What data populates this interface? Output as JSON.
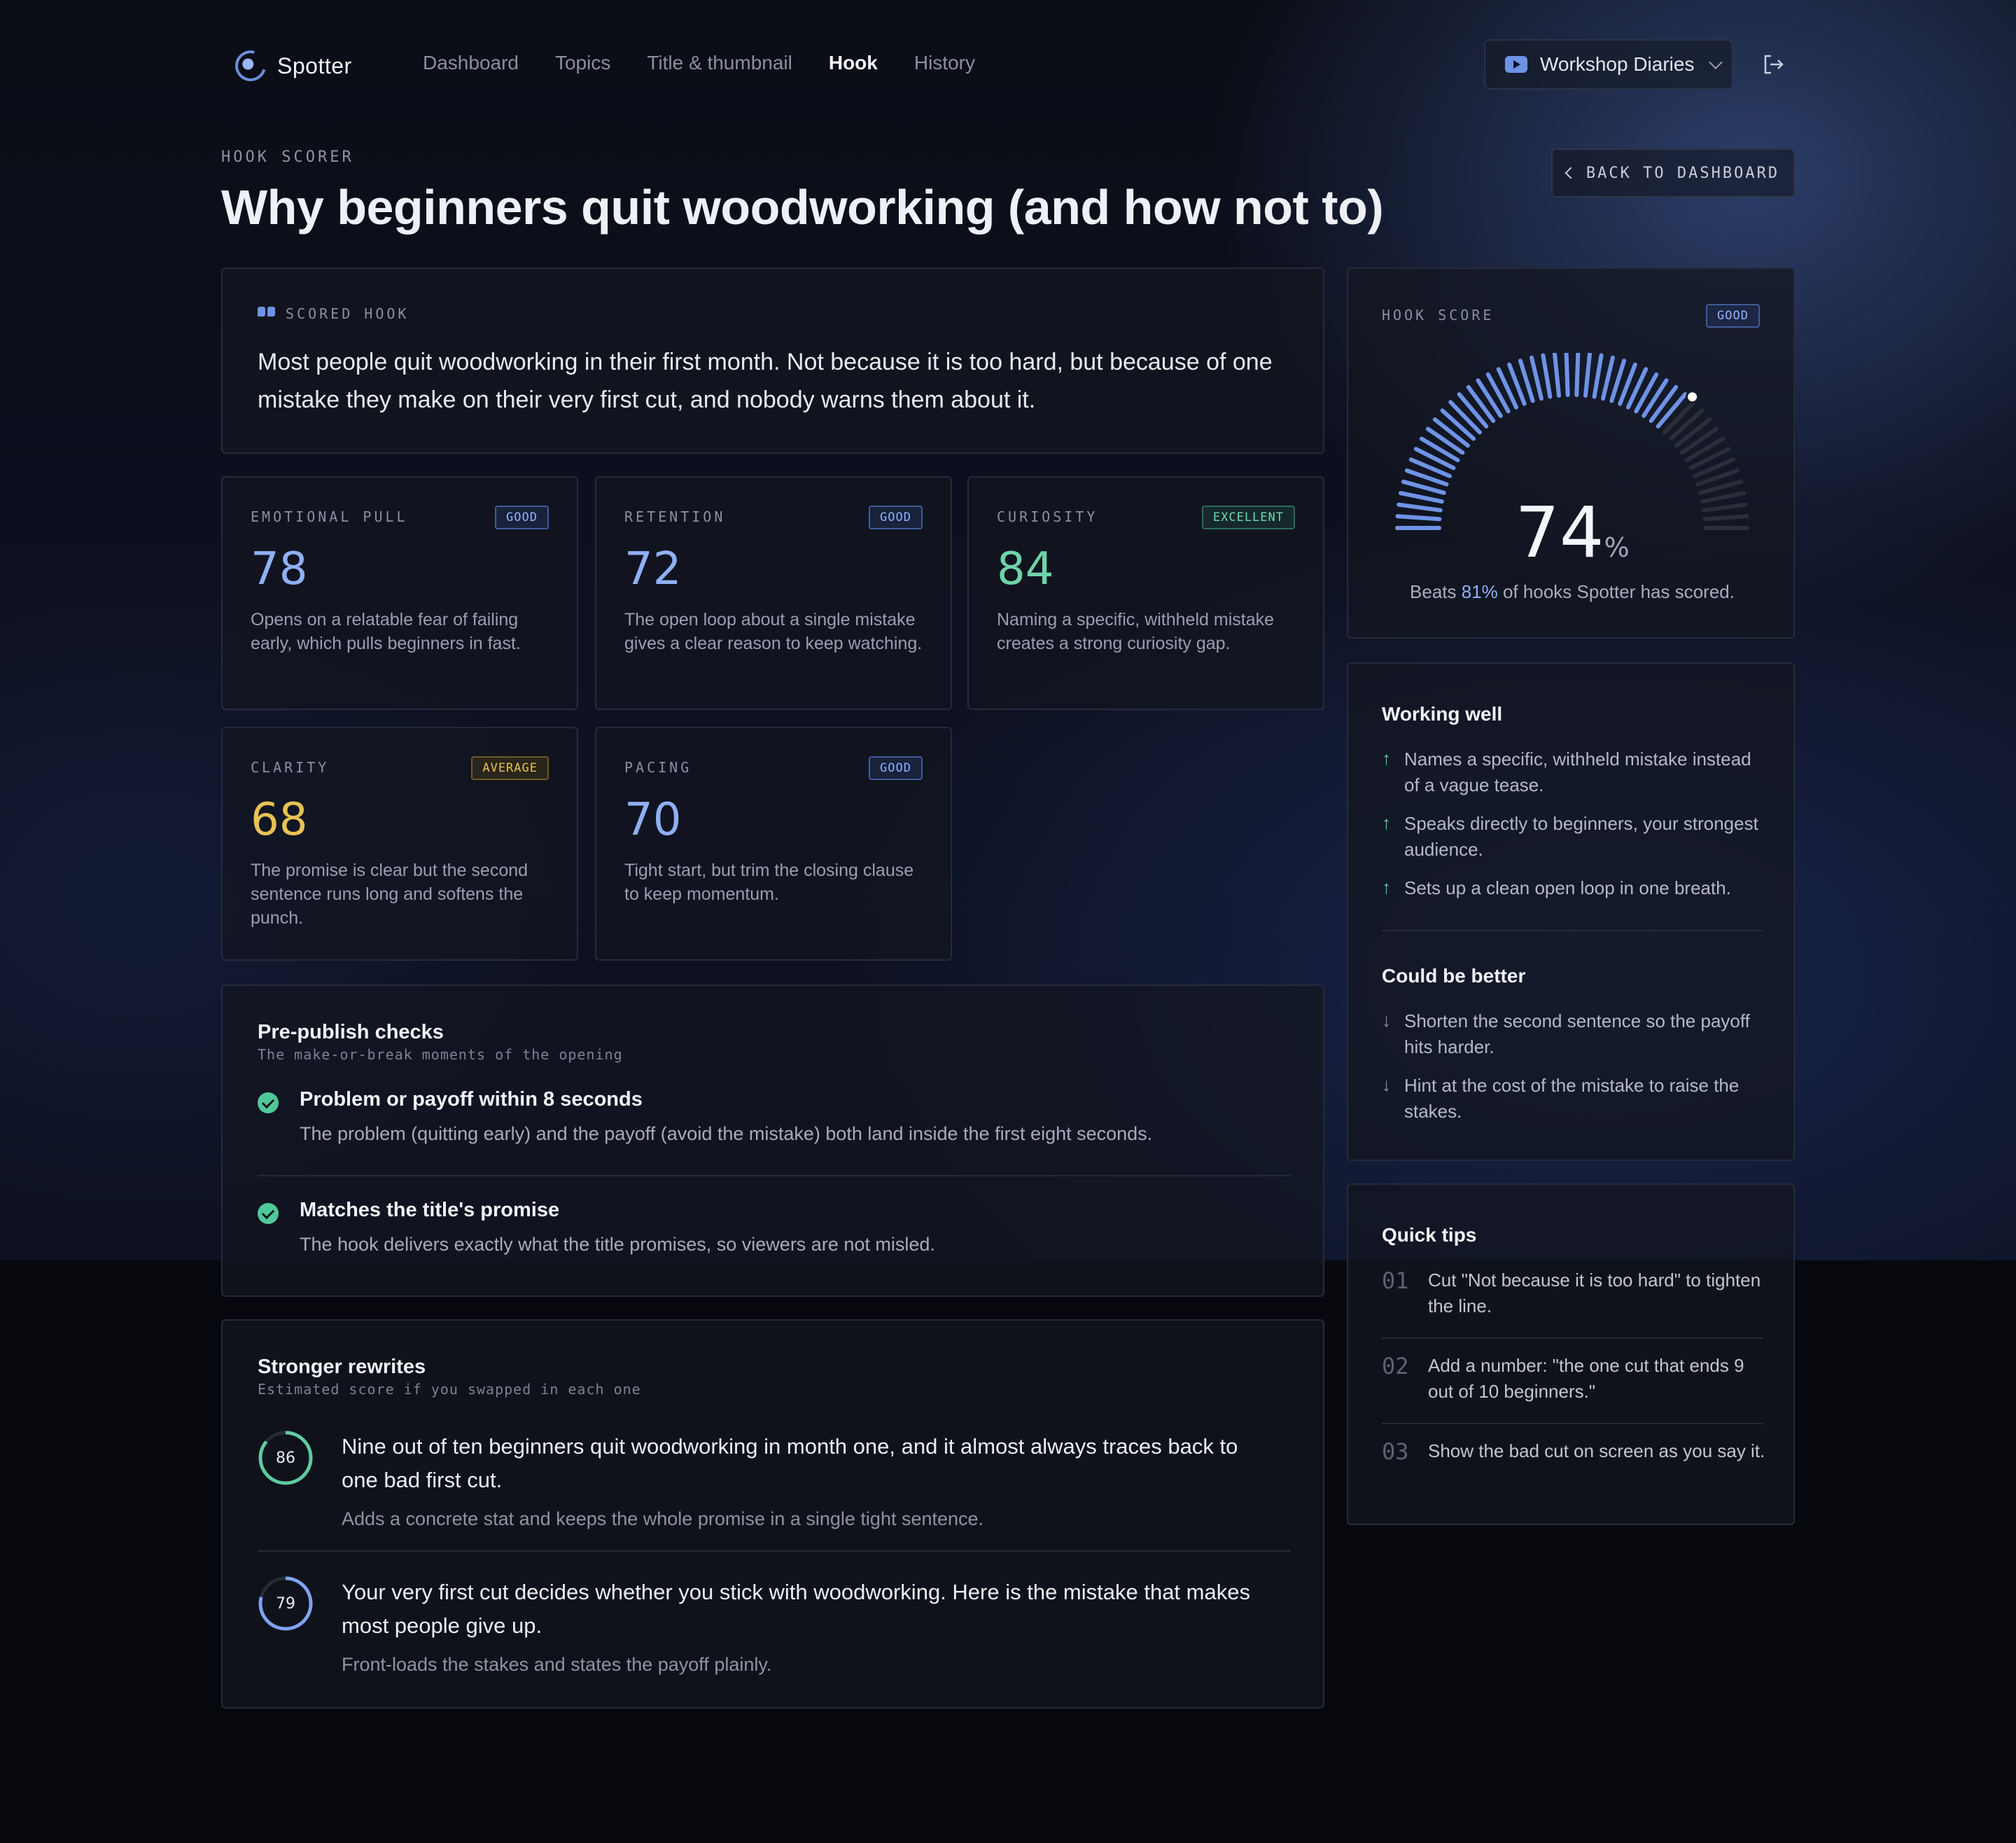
{
  "nav": {
    "brand": "Spotter",
    "links": [
      "Dashboard",
      "Topics",
      "Title & thumbnail",
      "Hook",
      "History"
    ],
    "channel": "Workshop Diaries"
  },
  "header": {
    "eyebrow": "HOOK SCORER",
    "title": "Why beginners quit woodworking (and how not to)",
    "back_label": "BACK TO DASHBOARD"
  },
  "hook": {
    "label": "SCORED HOOK",
    "text": "Most people quit woodworking in their first month. Not because it is too hard, but because of one mistake they make on their very first cut, and nobody warns them about it."
  },
  "metrics": [
    {
      "label": "EMOTIONAL PULL",
      "badge": "GOOD",
      "value": "78",
      "desc": "Opens on a relatable fear of failing early, which pulls beginners in fast."
    },
    {
      "label": "RETENTION",
      "badge": "GOOD",
      "value": "72",
      "desc": "The open loop about a single mistake gives a clear reason to keep watching."
    },
    {
      "label": "CURIOSITY",
      "badge": "EXCELLENT",
      "value": "84",
      "desc": "Naming a specific, withheld mistake creates a strong curiosity gap."
    },
    {
      "label": "CLARITY",
      "badge": "AVERAGE",
      "value": "68",
      "desc": "The promise is clear but the second sentence runs long and softens the punch."
    },
    {
      "label": "PACING",
      "badge": "GOOD",
      "value": "70",
      "desc": "Tight start, but trim the closing clause to keep momentum."
    }
  ],
  "checks": {
    "title": "Pre-publish checks",
    "subtitle": "The make-or-break moments of the opening",
    "items": [
      {
        "title": "Problem or payoff within 8 seconds",
        "desc": "The problem (quitting early) and the payoff (avoid the mistake) both land inside the first eight seconds."
      },
      {
        "title": "Matches the title's promise",
        "desc": "The hook delivers exactly what the title promises, so viewers are not misled."
      }
    ]
  },
  "rewrites": {
    "title": "Stronger rewrites",
    "subtitle": "Estimated score if you swapped in each one",
    "items": [
      {
        "score": "86",
        "score_value": 86,
        "color": "#5ecba0",
        "text": "Nine out of ten beginners quit woodworking in month one, and it almost always traces back to one bad first cut.",
        "note": "Adds a concrete stat and keeps the whole promise in a single tight sentence."
      },
      {
        "score": "79",
        "score_value": 79,
        "color": "#7fa2f0",
        "text": "Your very first cut decides whether you stick with woodworking. Here is the mistake that makes most people give up.",
        "note": "Front-loads the stakes and states the payoff plainly."
      }
    ]
  },
  "score": {
    "label": "HOOK SCORE",
    "badge": "GOOD",
    "value": "74",
    "value_num": 74,
    "unit": "%",
    "beats_prefix": "Beats ",
    "beats_pct": "81%",
    "beats_suffix": " of hooks Spotter has scored."
  },
  "working_well": {
    "title": "Working well",
    "items": [
      "Names a specific, withheld mistake instead of a vague tease.",
      "Speaks directly to beginners, your strongest audience.",
      "Sets up a clean open loop in one breath."
    ]
  },
  "could_be_better": {
    "title": "Could be better",
    "items": [
      "Shorten the second sentence so the payoff hits harder.",
      "Hint at the cost of the mistake to raise the stakes."
    ]
  },
  "tips": {
    "title": "Quick tips",
    "items": [
      {
        "num": "01",
        "text": "Cut \"Not because it is too hard\" to tighten the line."
      },
      {
        "num": "02",
        "text": "Add a number: \"the one cut that ends 9 out of 10 beginners.\""
      },
      {
        "num": "03",
        "text": "Show the bad cut on screen as you say it."
      }
    ]
  },
  "colors": {
    "accent": "#6e93e6",
    "good": "#8fb0f5",
    "excellent": "#6fd3a8",
    "average": "#e8c153"
  }
}
